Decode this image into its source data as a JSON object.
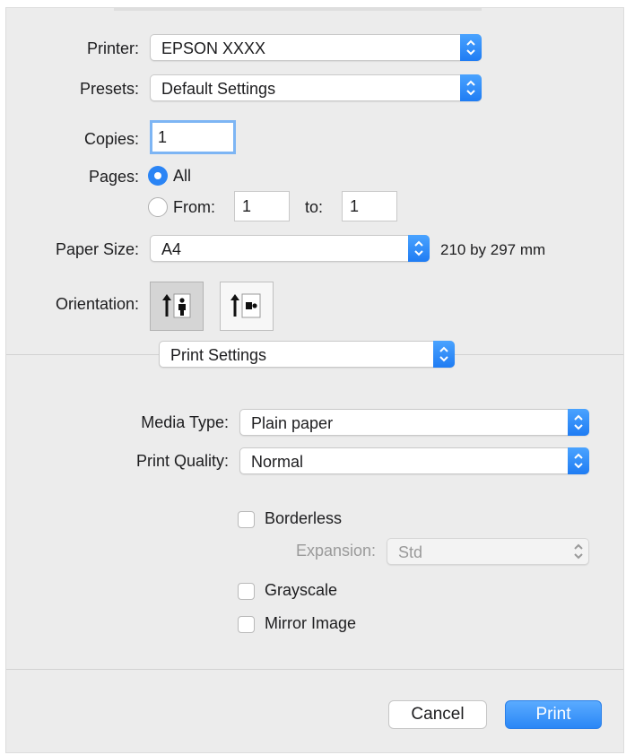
{
  "printer": {
    "label": "Printer:",
    "value": "EPSON XXXX"
  },
  "presets": {
    "label": "Presets:",
    "value": "Default Settings"
  },
  "copies": {
    "label": "Copies:",
    "value": "1"
  },
  "pages": {
    "label": "Pages:",
    "all_label": "All",
    "from_label": "From:",
    "from_value": "1",
    "to_label": "to:",
    "to_value": "1"
  },
  "paper_size": {
    "label": "Paper Size:",
    "value": "A4",
    "dimensions": "210 by 297 mm"
  },
  "orientation": {
    "label": "Orientation:",
    "selected": "portrait"
  },
  "panel_menu": {
    "value": "Print Settings"
  },
  "media_type": {
    "label": "Media Type:",
    "value": "Plain paper"
  },
  "print_quality": {
    "label": "Print Quality:",
    "value": "Normal"
  },
  "borderless": {
    "label": "Borderless",
    "checked": false
  },
  "expansion": {
    "label": "Expansion:",
    "value": "Std",
    "enabled": false
  },
  "grayscale": {
    "label": "Grayscale",
    "checked": false
  },
  "mirror_image": {
    "label": "Mirror Image",
    "checked": false
  },
  "buttons": {
    "cancel": "Cancel",
    "print": "Print"
  },
  "colors": {
    "accent": "#2a84f5",
    "background": "#ececec"
  }
}
